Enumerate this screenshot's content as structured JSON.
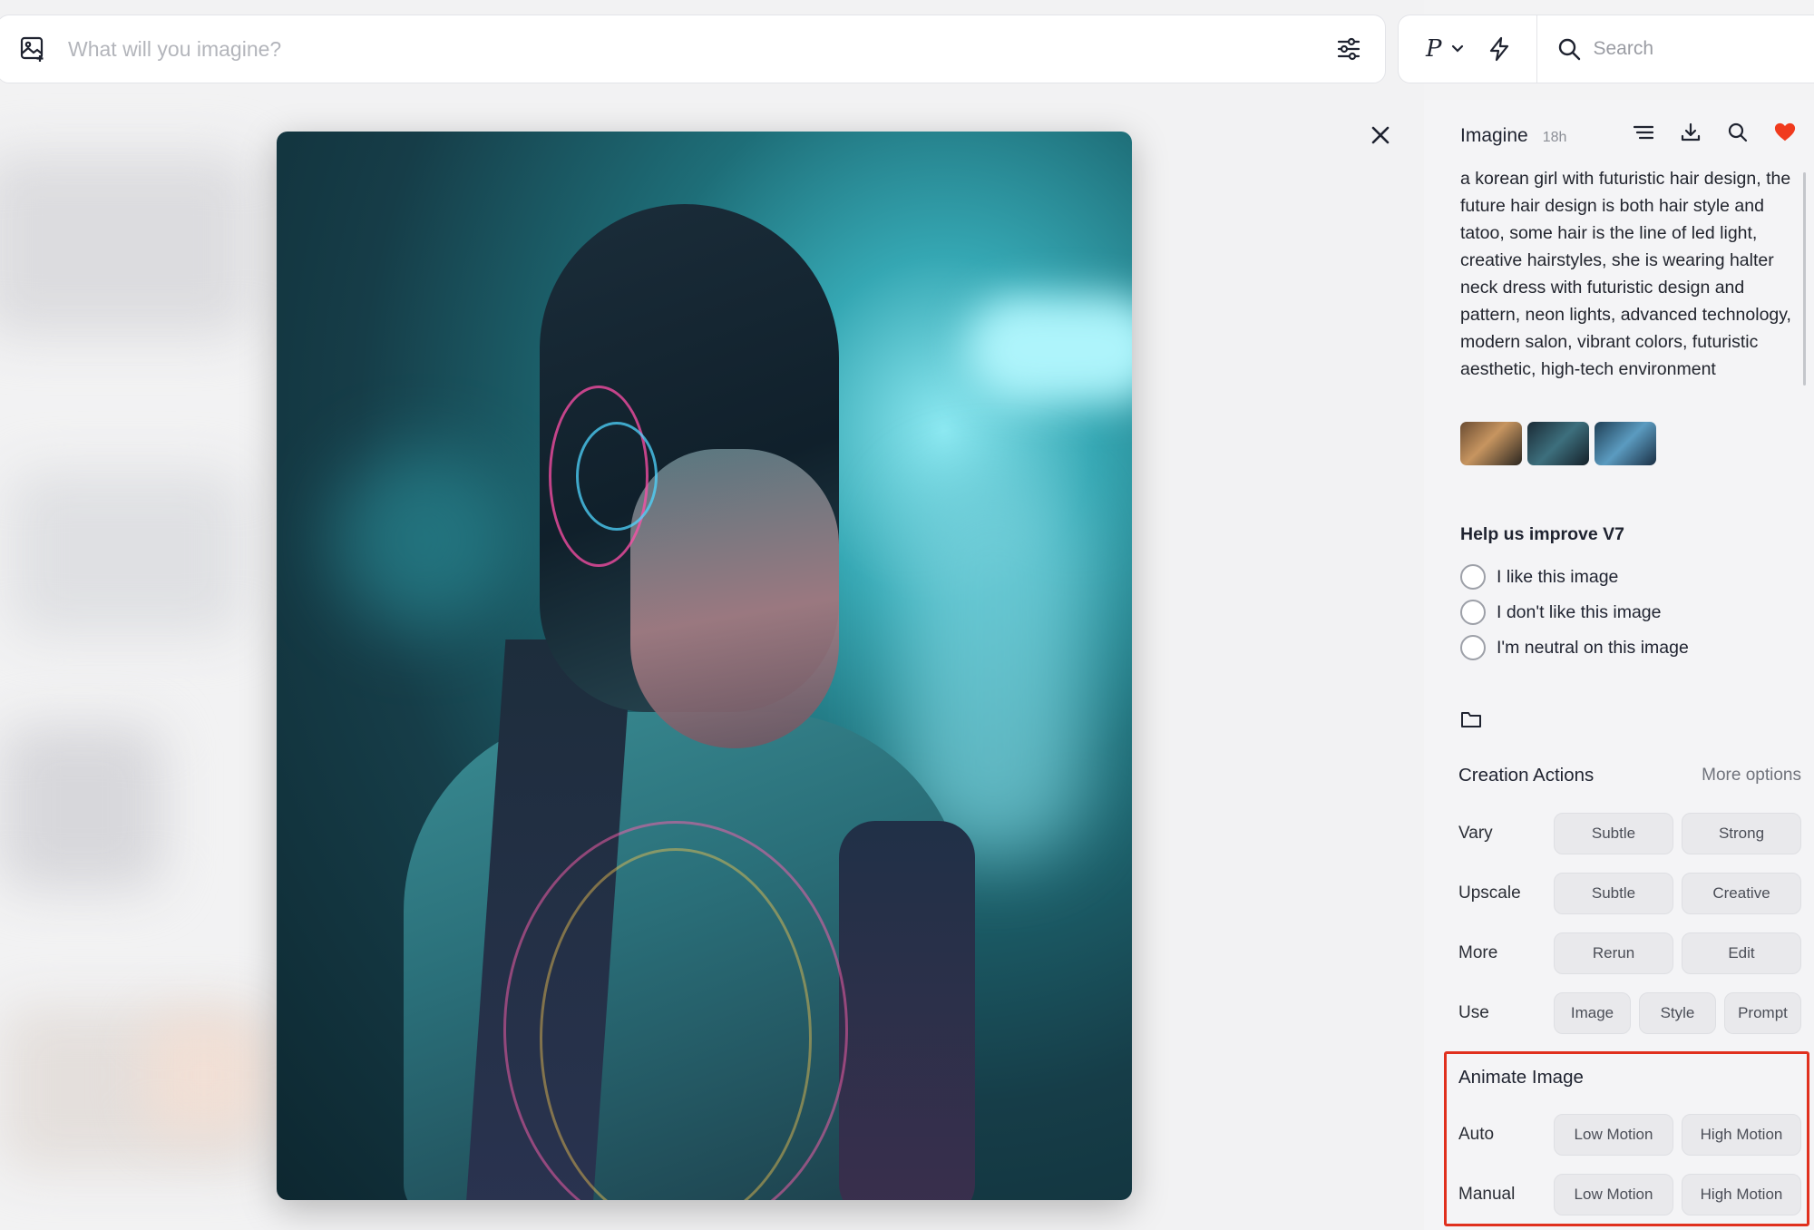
{
  "prompt_bar": {
    "placeholder": "What will you imagine?"
  },
  "top_right": {
    "personalize_letter": "P",
    "search_placeholder": "Search"
  },
  "sidebar": {
    "title": "Imagine",
    "age": "18h",
    "prompt": "a korean girl with futuristic hair design, the future hair design is both hair style and tatoo, some hair is the line of led light, creative hairstyles, she is wearing halter neck dress with futuristic design and pattern, neon lights, advanced technology, modern salon, vibrant colors, futuristic aesthetic, high-tech environment",
    "feedback": {
      "title": "Help us improve V7",
      "options": [
        "I like this image",
        "I don't like this image",
        "I'm neutral on this image"
      ]
    },
    "creation_actions": {
      "title": "Creation Actions",
      "more_options": "More options",
      "vary": {
        "label": "Vary",
        "buttons": [
          "Subtle",
          "Strong"
        ]
      },
      "upscale": {
        "label": "Upscale",
        "buttons": [
          "Subtle",
          "Creative"
        ]
      },
      "more": {
        "label": "More",
        "buttons": [
          "Rerun",
          "Edit"
        ]
      },
      "use": {
        "label": "Use",
        "buttons": [
          "Image",
          "Style",
          "Prompt"
        ]
      }
    },
    "animate": {
      "title": "Animate Image",
      "auto": {
        "label": "Auto",
        "buttons": [
          "Low Motion",
          "High Motion"
        ]
      },
      "manual": {
        "label": "Manual",
        "buttons": [
          "Low Motion",
          "High Motion"
        ]
      }
    }
  },
  "colors": {
    "accent_red": "#e0301e",
    "heart": "#f03a1d"
  }
}
